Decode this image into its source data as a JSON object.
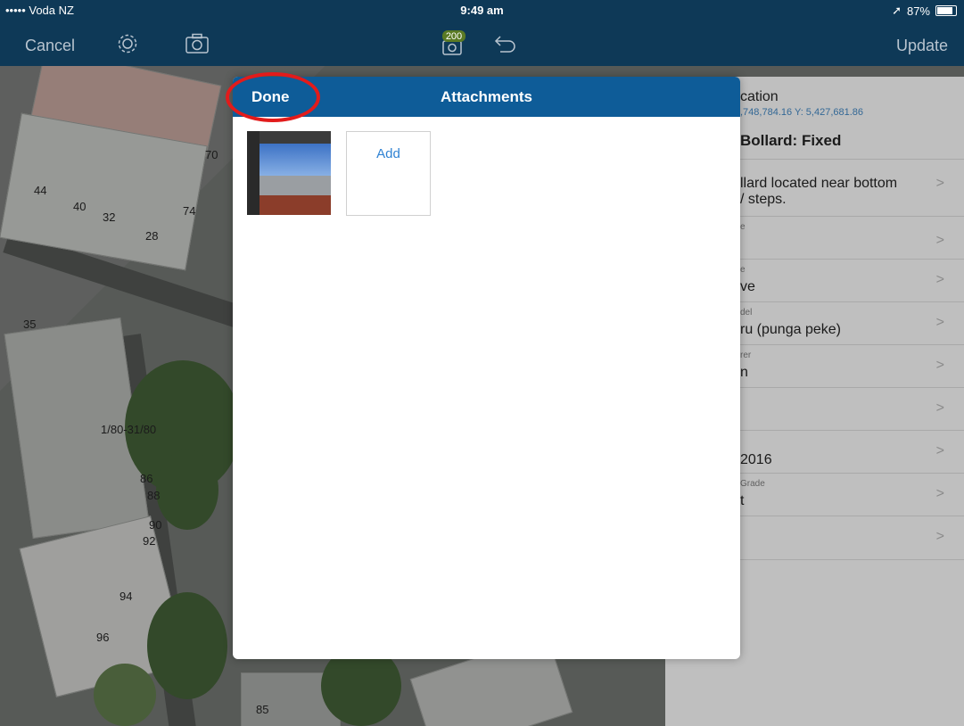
{
  "status_bar": {
    "carrier": "••••• Voda NZ",
    "time": "9:49 am",
    "battery": "87%"
  },
  "navbar": {
    "cancel_label": "Cancel",
    "update_label": "Update",
    "badge_count": "200",
    "icons": [
      "settings-gear-icon",
      "camera-icon",
      "photo-queue-icon",
      "undo-icon"
    ]
  },
  "map": {
    "labels": [
      "70",
      "44",
      "40",
      "32",
      "74",
      "28",
      "35",
      "1/80-31/80",
      "86",
      "88",
      "90",
      "92",
      "94",
      "96",
      "85"
    ]
  },
  "side_panel": {
    "title": "cation",
    "coords": ",748,784.16 Y: 5,427,681.86",
    "feature_type": "Bollard: Fixed",
    "rows": [
      {
        "small": "",
        "value": "llard located near bottom",
        "value2": "/ steps."
      },
      {
        "small": "e",
        "value": ""
      },
      {
        "small": "e",
        "value": "ve"
      },
      {
        "small": "del",
        "value": "ru (punga peke)"
      },
      {
        "small": "rer",
        "value": "n"
      },
      {
        "small": "",
        "value": ""
      },
      {
        "small": "",
        "value": "2016"
      },
      {
        "small": "Grade",
        "value": "t"
      },
      {
        "small": "",
        "value": ""
      }
    ]
  },
  "modal": {
    "done_label": "Done",
    "title": "Attachments",
    "add_label": "Add"
  },
  "colors": {
    "navbar": "#0e3957",
    "modal_header": "#0e5c98",
    "link_blue": "#2f82d3",
    "annotation_red": "#e21b1b"
  }
}
